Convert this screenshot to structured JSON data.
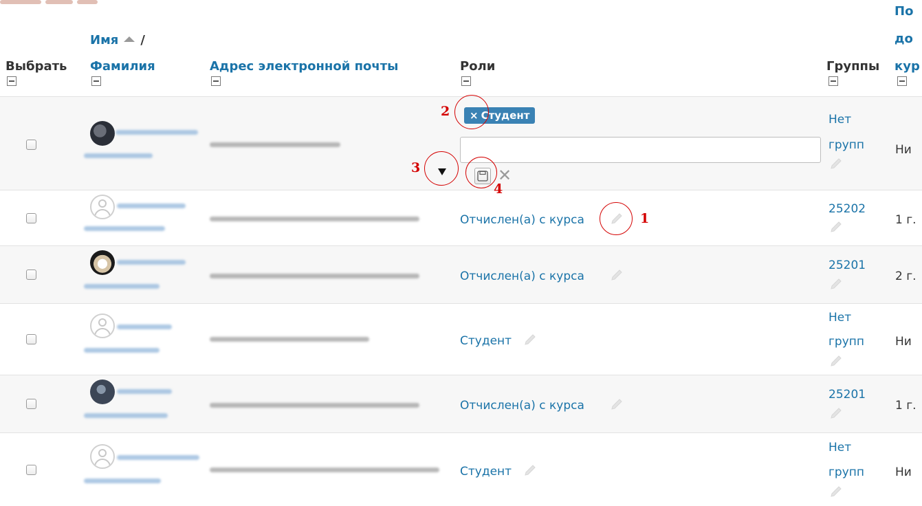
{
  "header": {
    "select": "Выбрать",
    "first_name": "Имя",
    "slash": "/",
    "last_name": "Фамилия",
    "email": "Адрес электронной почты",
    "roles": "Роли",
    "groups": "Группы",
    "last_access_1": "По",
    "last_access_2": "до",
    "last_access_3": "кур"
  },
  "edit_row": {
    "tag_remove": "×",
    "tag_label": "Студент",
    "groups_1": "Нет",
    "groups_2": "групп",
    "last_access": "Ни"
  },
  "rows": [
    {
      "role": "Отчислен(а) с курса",
      "group": "25202",
      "last_access": "1 г."
    },
    {
      "role": "Отчислен(а) с курса",
      "group": "25201",
      "last_access": "2 г."
    },
    {
      "role": "Студент",
      "group_1": "Нет",
      "group_2": "групп",
      "last_access": "Ни"
    },
    {
      "role": "Отчислен(а) с курса",
      "group": "25201",
      "last_access": "1 г."
    },
    {
      "role": "Студент",
      "group_1": "Нет",
      "group_2": "групп",
      "last_access": "Ни"
    }
  ],
  "annotations": {
    "n1": "1",
    "n2": "2",
    "n3": "3",
    "n4": "4"
  },
  "colors": {
    "link": "#1a73a8",
    "tag": "#3a82b4",
    "annotation": "#d40000"
  }
}
